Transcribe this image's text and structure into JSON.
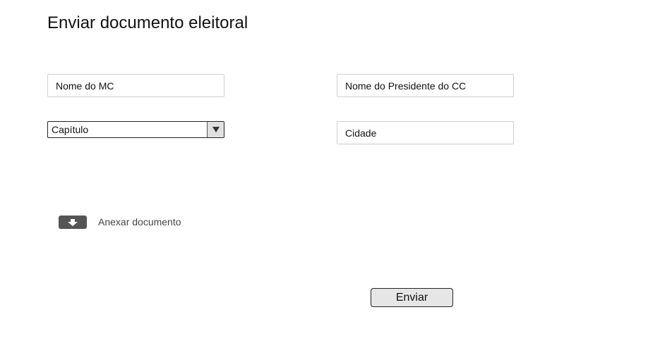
{
  "page": {
    "title": "Enviar documento eleitoral"
  },
  "form": {
    "mc_name": {
      "placeholder": "Nome do MC",
      "value": ""
    },
    "president_name": {
      "placeholder": "Nome do Presidente do CC",
      "value": ""
    },
    "chapter": {
      "selected": "Capítulo",
      "icon": "chevron-down-icon"
    },
    "city": {
      "placeholder": "Cidade",
      "value": ""
    },
    "attach": {
      "label": "Anexar documento",
      "icon": "download-arrow-icon"
    },
    "submit_label": "Enviar"
  },
  "colors": {
    "button_background": "#e6e6e6",
    "attach_icon_background": "#555555",
    "field_border": "#cfcfcf"
  }
}
